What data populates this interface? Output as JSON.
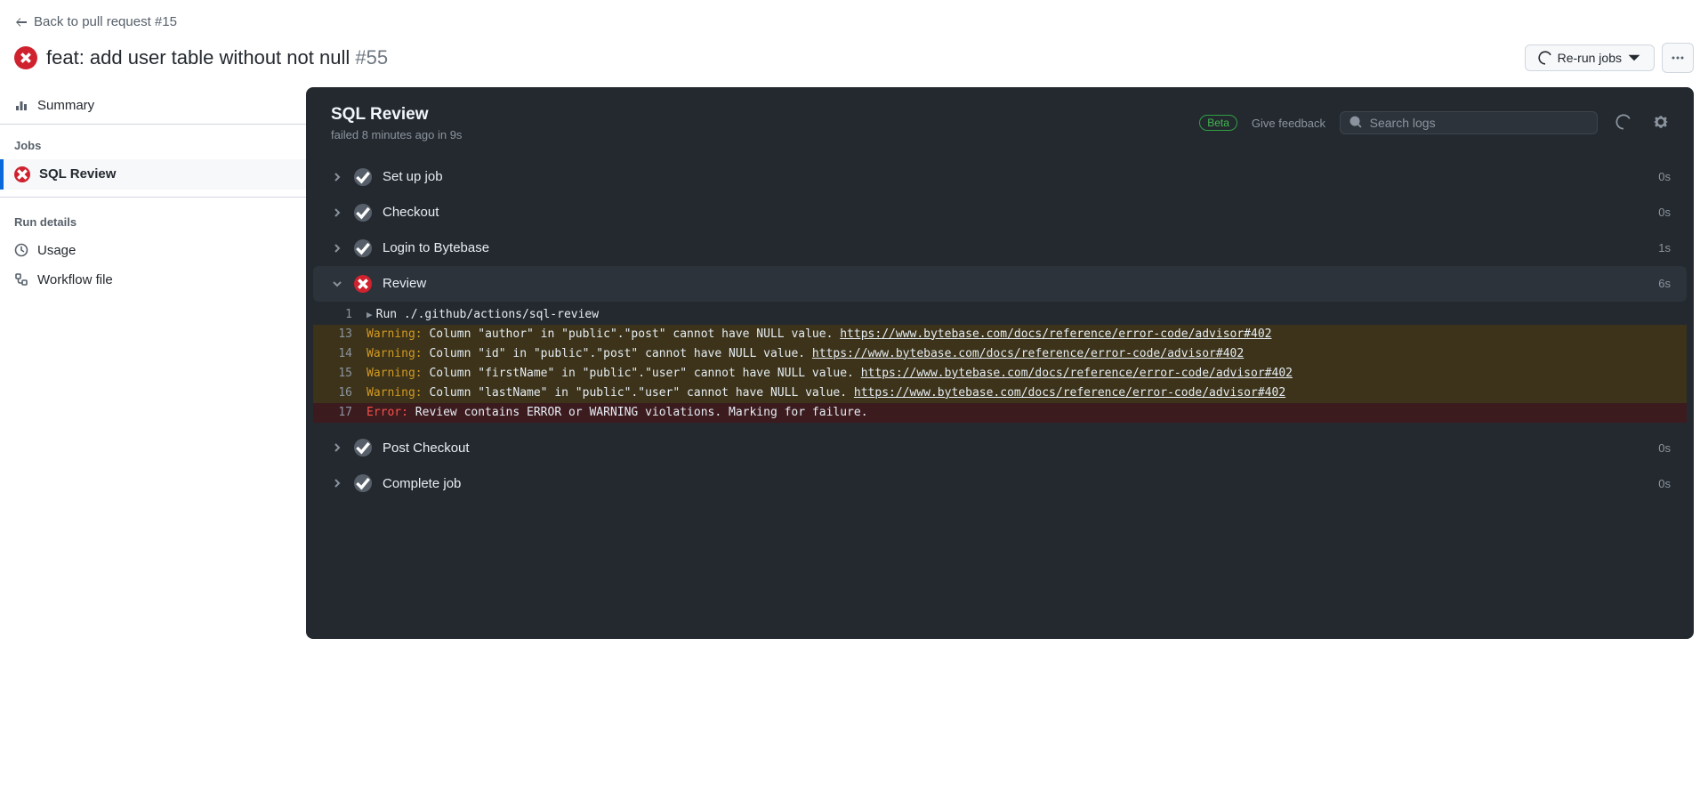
{
  "back_link": "Back to pull request #15",
  "run": {
    "title": "feat: add user table without not null",
    "number": "#55"
  },
  "actions": {
    "rerun": "Re-run jobs"
  },
  "sidebar": {
    "summary": "Summary",
    "jobs_heading": "Jobs",
    "jobs": [
      {
        "name": "SQL Review",
        "status": "fail"
      }
    ],
    "details_heading": "Run details",
    "details": [
      {
        "name": "Usage",
        "icon": "clock"
      },
      {
        "name": "Workflow file",
        "icon": "workflow"
      }
    ]
  },
  "job": {
    "title": "SQL Review",
    "subtitle": "failed 8 minutes ago in 9s",
    "beta": "Beta",
    "feedback": "Give feedback",
    "search_placeholder": "Search logs"
  },
  "steps": [
    {
      "name": "Set up job",
      "status": "pass",
      "duration": "0s",
      "expanded": false
    },
    {
      "name": "Checkout",
      "status": "pass",
      "duration": "0s",
      "expanded": false
    },
    {
      "name": "Login to Bytebase",
      "status": "pass",
      "duration": "1s",
      "expanded": false
    },
    {
      "name": "Review",
      "status": "fail",
      "duration": "6s",
      "expanded": true,
      "logs": [
        {
          "n": "1",
          "kind": "run",
          "parts": [
            {
              "t": "plain",
              "v": "Run ./.github/actions/sql-review"
            }
          ]
        },
        {
          "n": "13",
          "kind": "warn",
          "parts": [
            {
              "t": "warn",
              "v": "Warning:"
            },
            {
              "t": "plain",
              "v": " Column \"author\" in \"public\".\"post\" cannot have NULL value. "
            },
            {
              "t": "link",
              "v": "https://www.bytebase.com/docs/reference/error-code/advisor#402"
            }
          ]
        },
        {
          "n": "14",
          "kind": "warn",
          "parts": [
            {
              "t": "warn",
              "v": "Warning:"
            },
            {
              "t": "plain",
              "v": " Column \"id\" in \"public\".\"post\" cannot have NULL value. "
            },
            {
              "t": "link",
              "v": "https://www.bytebase.com/docs/reference/error-code/advisor#402"
            }
          ]
        },
        {
          "n": "15",
          "kind": "warn",
          "parts": [
            {
              "t": "warn",
              "v": "Warning:"
            },
            {
              "t": "plain",
              "v": " Column \"firstName\" in \"public\".\"user\" cannot have NULL value. "
            },
            {
              "t": "link",
              "v": "https://www.bytebase.com/docs/reference/error-code/advisor#402"
            }
          ]
        },
        {
          "n": "16",
          "kind": "warn",
          "parts": [
            {
              "t": "warn",
              "v": "Warning:"
            },
            {
              "t": "plain",
              "v": " Column \"lastName\" in \"public\".\"user\" cannot have NULL value. "
            },
            {
              "t": "link",
              "v": "https://www.bytebase.com/docs/reference/error-code/advisor#402"
            }
          ]
        },
        {
          "n": "17",
          "kind": "err",
          "parts": [
            {
              "t": "err",
              "v": "Error:"
            },
            {
              "t": "plain",
              "v": " Review contains ERROR or WARNING violations. Marking for failure."
            }
          ]
        }
      ]
    },
    {
      "name": "Post Checkout",
      "status": "pass",
      "duration": "0s",
      "expanded": false
    },
    {
      "name": "Complete job",
      "status": "pass",
      "duration": "0s",
      "expanded": false
    }
  ]
}
